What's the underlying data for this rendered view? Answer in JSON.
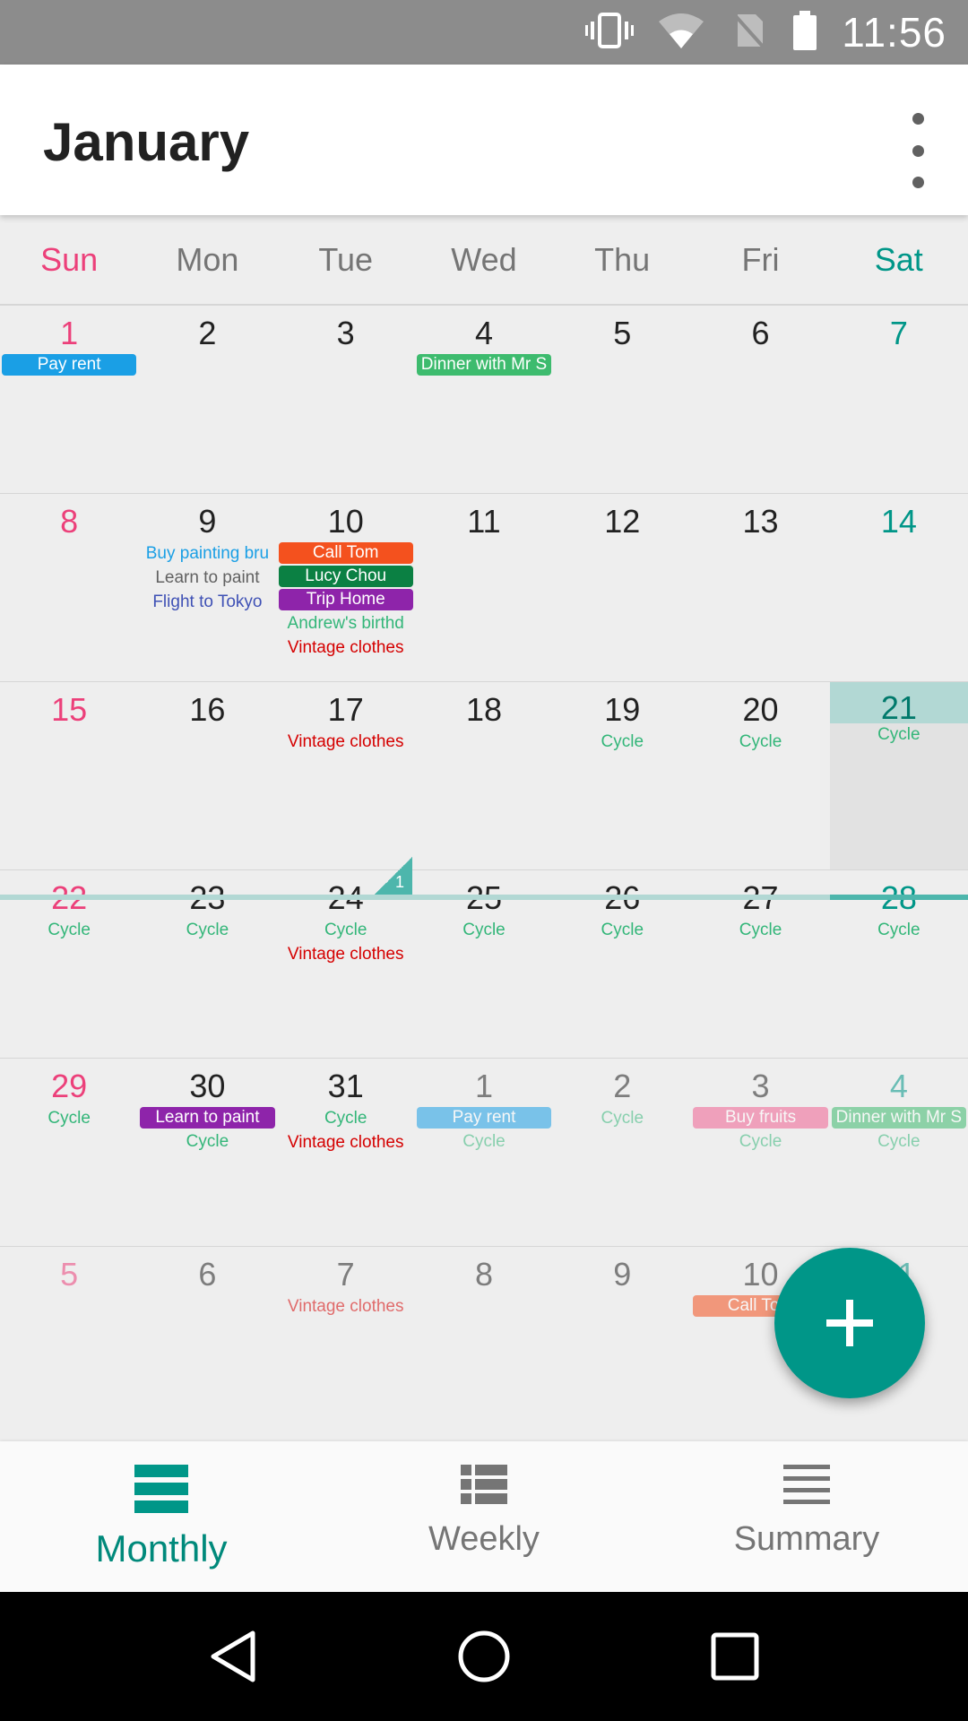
{
  "status_bar": {
    "time": "11:56"
  },
  "app_bar": {
    "title": "January"
  },
  "weekdays": [
    "Sun",
    "Mon",
    "Tue",
    "Wed",
    "Thu",
    "Fri",
    "Sat"
  ],
  "weeks": [
    {
      "days": [
        {
          "num": "1",
          "events": [
            {
              "text": "Pay rent",
              "style": "chip",
              "color": "#1a9fe5"
            }
          ]
        },
        {
          "num": "2",
          "events": []
        },
        {
          "num": "3",
          "events": []
        },
        {
          "num": "4",
          "events": [
            {
              "text": "Dinner with Mr S",
              "style": "chip",
              "color": "#3dbb6e"
            }
          ]
        },
        {
          "num": "5",
          "events": []
        },
        {
          "num": "6",
          "events": []
        },
        {
          "num": "7",
          "events": []
        }
      ]
    },
    {
      "days": [
        {
          "num": "8",
          "events": []
        },
        {
          "num": "9",
          "events": [
            {
              "text": "Buy painting bru",
              "style": "text",
              "color": "#1a9fe5"
            },
            {
              "text": "Learn to paint",
              "style": "text",
              "color": "#616161"
            },
            {
              "text": "Flight to Tokyo",
              "style": "text",
              "color": "#3f51b5"
            }
          ]
        },
        {
          "num": "10",
          "events": [
            {
              "text": "Call Tom",
              "style": "chip",
              "color": "#f4511e"
            },
            {
              "text": "Lucy Chou",
              "style": "chip",
              "color": "#0b8043"
            },
            {
              "text": "Trip Home",
              "style": "chip",
              "color": "#8e24aa"
            },
            {
              "text": "Andrew's birthd",
              "style": "text",
              "color": "#33b679"
            },
            {
              "text": "Vintage clothes",
              "style": "text",
              "color": "#d50000"
            }
          ],
          "more": "1"
        },
        {
          "num": "11",
          "events": []
        },
        {
          "num": "12",
          "events": []
        },
        {
          "num": "13",
          "events": []
        },
        {
          "num": "14",
          "events": []
        }
      ]
    },
    {
      "days": [
        {
          "num": "15",
          "events": []
        },
        {
          "num": "16",
          "events": []
        },
        {
          "num": "17",
          "events": [
            {
              "text": "Vintage clothes",
              "style": "text",
              "color": "#d50000"
            }
          ]
        },
        {
          "num": "18",
          "events": []
        },
        {
          "num": "19",
          "events": [
            {
              "text": "Cycle",
              "style": "text",
              "color": "#33b679"
            }
          ]
        },
        {
          "num": "20",
          "events": [
            {
              "text": "Cycle",
              "style": "text",
              "color": "#33b679"
            }
          ]
        },
        {
          "num": "21",
          "events": [
            {
              "text": "Cycle",
              "style": "text",
              "color": "#33b679"
            }
          ],
          "today": true
        }
      ]
    },
    {
      "days": [
        {
          "num": "22",
          "events": [
            {
              "text": "Cycle",
              "style": "text",
              "color": "#33b679"
            }
          ]
        },
        {
          "num": "23",
          "events": [
            {
              "text": "Cycle",
              "style": "text",
              "color": "#33b679"
            }
          ]
        },
        {
          "num": "24",
          "events": [
            {
              "text": "Cycle",
              "style": "text",
              "color": "#33b679"
            },
            {
              "text": "Vintage clothes",
              "style": "text",
              "color": "#d50000"
            }
          ]
        },
        {
          "num": "25",
          "events": [
            {
              "text": "Cycle",
              "style": "text",
              "color": "#33b679"
            }
          ]
        },
        {
          "num": "26",
          "events": [
            {
              "text": "Cycle",
              "style": "text",
              "color": "#33b679"
            }
          ]
        },
        {
          "num": "27",
          "events": [
            {
              "text": "Cycle",
              "style": "text",
              "color": "#33b679"
            }
          ]
        },
        {
          "num": "28",
          "events": [
            {
              "text": "Cycle",
              "style": "text",
              "color": "#33b679"
            }
          ]
        }
      ]
    },
    {
      "days": [
        {
          "num": "29",
          "events": [
            {
              "text": "Cycle",
              "style": "text",
              "color": "#33b679"
            }
          ]
        },
        {
          "num": "30",
          "events": [
            {
              "text": "Learn to paint",
              "style": "chip",
              "color": "#8e24aa"
            },
            {
              "text": "Cycle",
              "style": "text",
              "color": "#33b679"
            }
          ]
        },
        {
          "num": "31",
          "events": [
            {
              "text": "Cycle",
              "style": "text",
              "color": "#33b679"
            },
            {
              "text": "Vintage clothes",
              "style": "text",
              "color": "#d50000"
            }
          ]
        },
        {
          "num": "1",
          "dim": true,
          "events": [
            {
              "text": "Pay rent",
              "style": "chip",
              "color": "#1a9fe5"
            },
            {
              "text": "Cycle",
              "style": "text",
              "color": "#33b679"
            }
          ]
        },
        {
          "num": "2",
          "dim": true,
          "events": [
            {
              "text": "Cycle",
              "style": "text",
              "color": "#33b679"
            }
          ]
        },
        {
          "num": "3",
          "dim": true,
          "events": [
            {
              "text": "Buy fruits",
              "style": "chip",
              "color": "#f06292"
            },
            {
              "text": "Cycle",
              "style": "text",
              "color": "#33b679"
            }
          ]
        },
        {
          "num": "4",
          "dim": true,
          "events": [
            {
              "text": "Dinner with Mr S",
              "style": "chip",
              "color": "#3dbb6e"
            },
            {
              "text": "Cycle",
              "style": "text",
              "color": "#33b679"
            }
          ]
        }
      ]
    },
    {
      "days": [
        {
          "num": "5",
          "dim": true,
          "events": []
        },
        {
          "num": "6",
          "dim": true,
          "events": []
        },
        {
          "num": "7",
          "dim": true,
          "events": [
            {
              "text": "Vintage clothes",
              "style": "text",
              "color": "#d50000"
            }
          ]
        },
        {
          "num": "8",
          "dim": true,
          "events": []
        },
        {
          "num": "9",
          "dim": true,
          "events": []
        },
        {
          "num": "10",
          "dim": true,
          "events": [
            {
              "text": "Call Tom",
              "style": "chip",
              "color": "#f4511e"
            }
          ]
        },
        {
          "num": "11",
          "dim": true,
          "events": []
        }
      ]
    }
  ],
  "bottom_nav": [
    {
      "label": "Monthly",
      "icon": "monthly-view-icon",
      "active": true
    },
    {
      "label": "Weekly",
      "icon": "weekly-list-icon",
      "active": false
    },
    {
      "label": "Summary",
      "icon": "summary-lines-icon",
      "active": false
    }
  ],
  "colors": {
    "accent": "#009688",
    "sunday": "#ec407a",
    "today_bg": "#b2d8d4"
  }
}
